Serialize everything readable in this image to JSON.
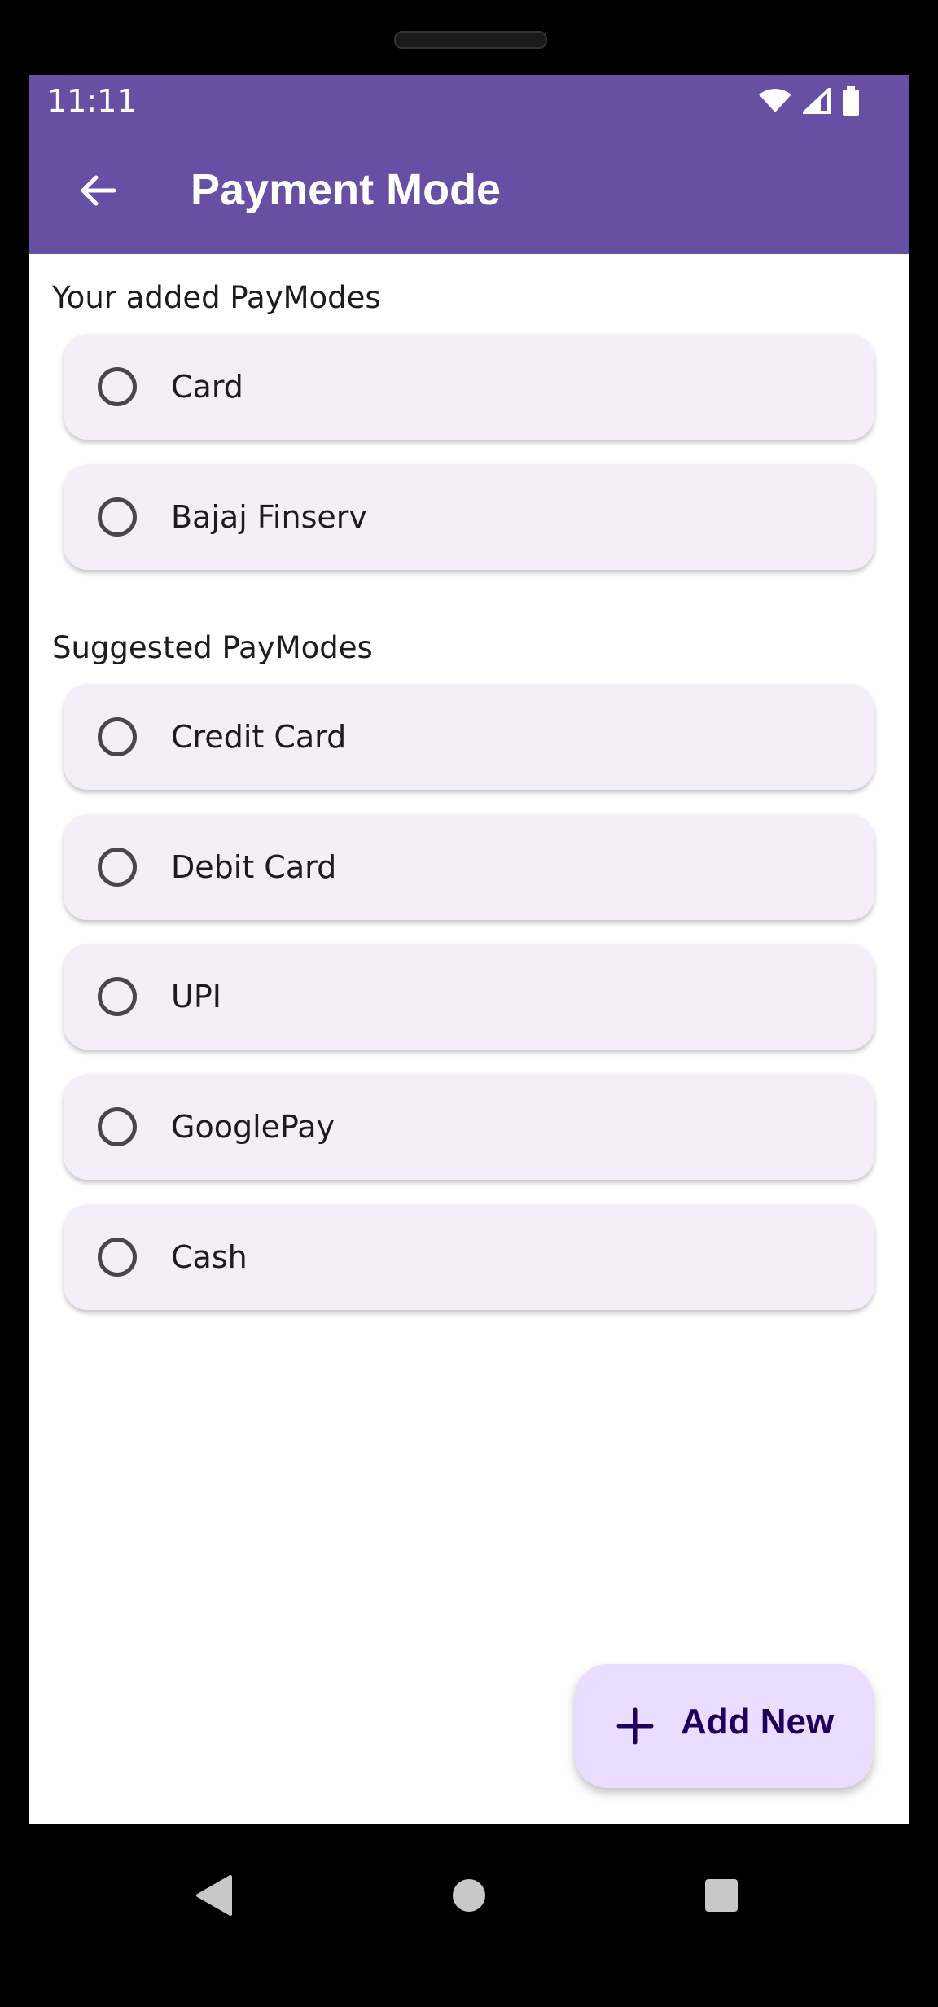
{
  "status_bar": {
    "time": "11:11",
    "icons": [
      "wifi-icon",
      "cellular-signal-icon",
      "battery-icon"
    ]
  },
  "app_bar": {
    "title": "Payment Mode",
    "back_icon": "arrow-back-icon",
    "color": "#6750A4"
  },
  "added_section": {
    "label": "Your added PayModes",
    "items": [
      {
        "label": "Card",
        "selected": false
      },
      {
        "label": "Bajaj Finserv",
        "selected": false
      }
    ]
  },
  "suggested_section": {
    "label": "Suggested PayModes",
    "items": [
      {
        "label": "Credit Card",
        "selected": false
      },
      {
        "label": "Debit Card",
        "selected": false
      },
      {
        "label": "UPI",
        "selected": false
      },
      {
        "label": "GooglePay",
        "selected": false
      },
      {
        "label": "Cash",
        "selected": false
      }
    ]
  },
  "fab": {
    "label": "Add New",
    "icon": "plus-icon",
    "background": "#EADDFF"
  },
  "nav_bar": {
    "buttons": [
      "back-triangle-icon",
      "home-circle-icon",
      "recents-square-icon"
    ]
  }
}
